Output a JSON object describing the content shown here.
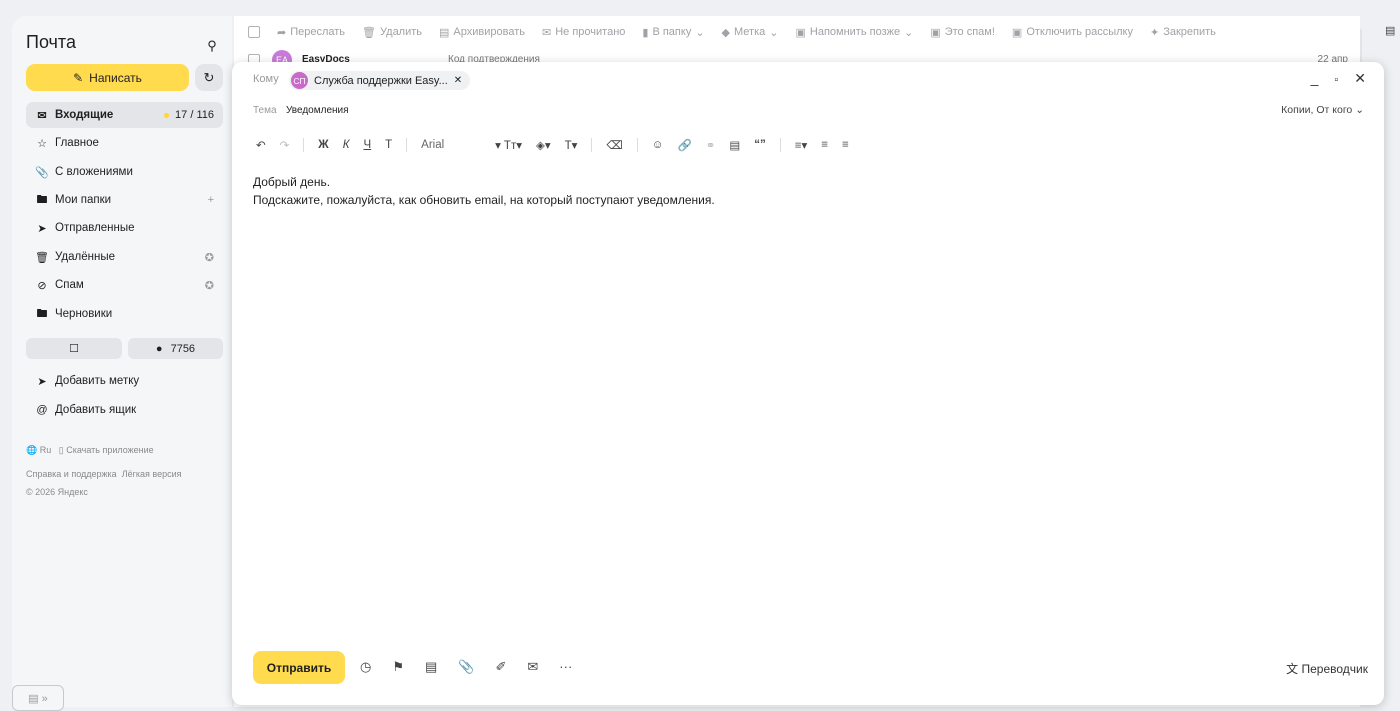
{
  "sidebar": {
    "logo": "Почта",
    "compose_label": "Написать",
    "nav": [
      {
        "label": "Входящие",
        "count": "17 / 116"
      },
      {
        "label": "Главное"
      },
      {
        "label": "С вложениями"
      },
      {
        "label": "Мои папки",
        "extra": "+"
      },
      {
        "label": "Отправленные"
      },
      {
        "label": "Удалённые"
      },
      {
        "label": "Спам"
      },
      {
        "label": "Черновики"
      }
    ],
    "pill_count": "7756",
    "add_label": "Добавить метку",
    "add_box": "Добавить ящик",
    "footer": {
      "lang": "Ru",
      "download": "Скачать приложение",
      "help": "Справка и поддержка",
      "lite": "Лёгкая версия",
      "copyright": "© 2026 Яндекс"
    }
  },
  "toolbar": {
    "forward": "Переслать",
    "delete": "Удалить",
    "archive": "Архивировать",
    "unread": "Не прочитано",
    "to_folder": "В папку",
    "label": "Метка",
    "remind": "Напомнить позже",
    "spam": "Это спам!",
    "unsubscribe": "Отключить рассылку",
    "pin": "Закрепить"
  },
  "mail_row": {
    "avatar": "EA",
    "sender": "EasyDocs",
    "subject": "Код подтверждения",
    "date": "22 апр"
  },
  "compose": {
    "to_label": "Кому",
    "recipient_initials": "СП",
    "recipient": "Служба поддержки Easy...",
    "subject_label": "Тема",
    "subject": "Уведомления",
    "cc_label": "Копии, От кого",
    "font": "Arial",
    "body_line1": "Добрый день.",
    "body_line2": "Подскажите, пожалуйста, как обновить email, на который поступают уведомления.",
    "send_label": "Отправить",
    "translator_label": "Переводчик"
  }
}
